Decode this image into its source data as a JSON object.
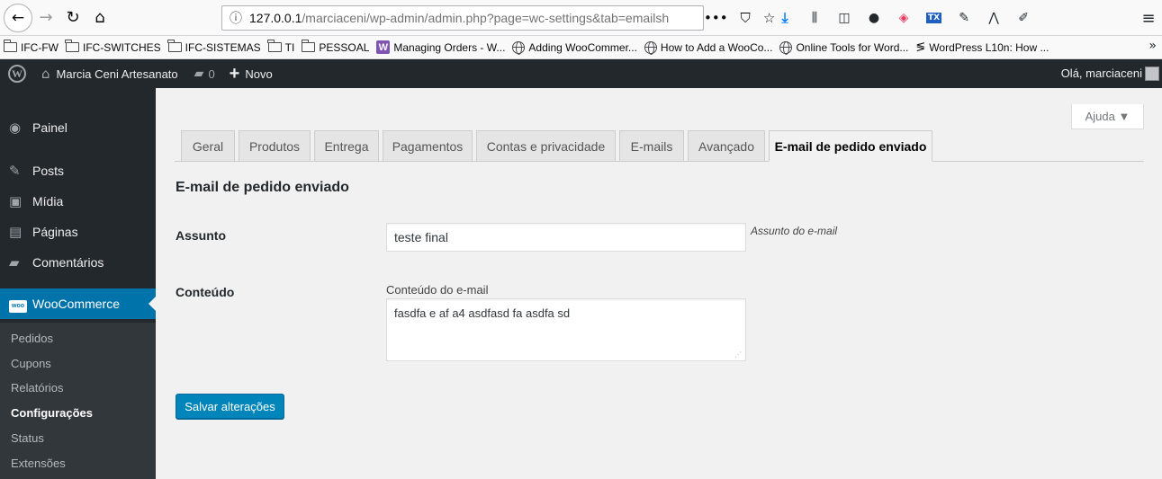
{
  "browser": {
    "url_host": "127.0.0.1",
    "url_rest": "/marciaceni/wp-admin/admin.php?page=wc-settings&tab=emailsh",
    "url_dots": "•••",
    "pocket_glyph": "⛉",
    "star_glyph": "☆",
    "ext_tx": "TX",
    "menu_glyph": "≡"
  },
  "bookmarks": [
    {
      "label": "IFC-FW",
      "icon": "folder-icon"
    },
    {
      "label": "IFC-SWITCHES",
      "icon": "folder-icon"
    },
    {
      "label": "IFC-SISTEMAS",
      "icon": "folder-icon"
    },
    {
      "label": "TI",
      "icon": "folder-icon"
    },
    {
      "label": "PESSOAL",
      "icon": "folder-icon"
    },
    {
      "label": "Managing Orders - W...",
      "icon": "woo-icon",
      "icon_text": "W"
    },
    {
      "label": "Adding WooCommer...",
      "icon": "globe-icon"
    },
    {
      "label": "How to Add a WooCo...",
      "icon": "globe-icon"
    },
    {
      "label": "Online Tools for Word...",
      "icon": "globe-icon"
    },
    {
      "label": "WordPress L10n: How ...",
      "icon": "l10n-icon"
    }
  ],
  "adminbar": {
    "site_name": "Marcia Ceni Artesanato",
    "comment_count": "0",
    "new_label": "Novo",
    "howdy": "Olá, marciaceni"
  },
  "sidebar": {
    "items": [
      {
        "label": "Painel",
        "icon": "dashboard-icon"
      },
      {
        "label": "Posts",
        "icon": "pin-icon"
      },
      {
        "label": "Mídia",
        "icon": "media-icon"
      },
      {
        "label": "Páginas",
        "icon": "pages-icon"
      },
      {
        "label": "Comentários",
        "icon": "comments-icon"
      },
      {
        "label": "WooCommerce",
        "icon": "woocommerce-icon",
        "badge": "woo"
      }
    ],
    "submenu": [
      "Pedidos",
      "Cupons",
      "Relatórios",
      "Configurações",
      "Status",
      "Extensões"
    ],
    "current_sub": "Configurações"
  },
  "help_tab": {
    "label": "Ajuda ▼"
  },
  "tabs": [
    {
      "label": "Geral"
    },
    {
      "label": "Produtos"
    },
    {
      "label": "Entrega"
    },
    {
      "label": "Pagamentos"
    },
    {
      "label": "Contas e privacidade"
    },
    {
      "label": "E-mails"
    },
    {
      "label": "Avançado"
    },
    {
      "label": "E-mail de pedido enviado",
      "active": true
    }
  ],
  "form": {
    "title": "E-mail de pedido enviado",
    "subject_label": "Assunto",
    "subject_value": "teste final",
    "subject_help": "Assunto do e-mail",
    "content_label": "Conteúdo",
    "content_caption": "Conteúdo do e-mail",
    "content_value": "fasdfa e af a4 asdfasd fa asdfa sd",
    "save_label": "Salvar alterações"
  },
  "colors": {
    "admin_dark": "#23282d",
    "primary_blue": "#0073aa",
    "button_blue": "#0085ba"
  }
}
